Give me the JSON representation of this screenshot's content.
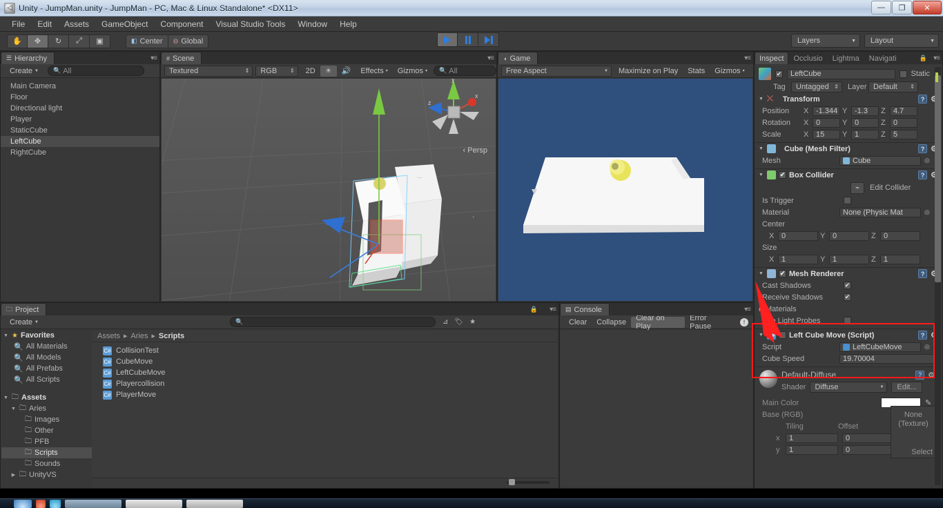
{
  "window": {
    "title": "Unity - JumpMan.unity - JumpMan - PC, Mac & Linux Standalone* <DX11>",
    "app_icon": "unity-icon",
    "minimize": "—",
    "restore": "❐",
    "close": "✕"
  },
  "menubar": {
    "items": [
      "File",
      "Edit",
      "Assets",
      "GameObject",
      "Component",
      "Visual Studio Tools",
      "Window",
      "Help"
    ]
  },
  "toolbar": {
    "tools": [
      {
        "name": "hand-tool",
        "glyph": "✋",
        "active": false
      },
      {
        "name": "move-tool",
        "glyph": "✥",
        "active": true
      },
      {
        "name": "rotate-tool",
        "glyph": "↻",
        "active": false
      },
      {
        "name": "scale-tool",
        "glyph": "⤢",
        "active": false
      },
      {
        "name": "rect-tool",
        "glyph": "▣",
        "active": false
      }
    ],
    "pivot_label": "Center",
    "space_label": "Global",
    "play_label": "Play",
    "pause_label": "Pause",
    "step_label": "Step",
    "layers_label": "Layers",
    "layout_label": "Layout"
  },
  "hierarchy": {
    "tab": "Hierarchy",
    "create_label": "Create",
    "search_placeholder": "All",
    "items": [
      {
        "label": "Main Camera",
        "selected": false
      },
      {
        "label": "Floor",
        "selected": false
      },
      {
        "label": "Directional light",
        "selected": false
      },
      {
        "label": "Player",
        "selected": false
      },
      {
        "label": "StaticCube",
        "selected": false
      },
      {
        "label": "LeftCube",
        "selected": true
      },
      {
        "label": "RightCube",
        "selected": false
      }
    ]
  },
  "scene": {
    "tab": "Scene",
    "draw_mode": "Textured",
    "color_mode": "RGB",
    "two_d": "2D",
    "effects": "Effects",
    "gizmos": "Gizmos",
    "search_placeholder": "All",
    "persp_label": "Persp",
    "axis_x": "x",
    "axis_y": "y",
    "axis_z": "z"
  },
  "game": {
    "tab": "Game",
    "aspect": "Free Aspect",
    "maximize": "Maximize on Play",
    "stats": "Stats",
    "gizmos": "Gizmos"
  },
  "project": {
    "tab": "Project",
    "create_label": "Create",
    "search_placeholder": "",
    "breadcrumb": [
      "Assets",
      "Aries",
      "Scripts"
    ],
    "favorites_label": "Favorites",
    "favorites": [
      "All Materials",
      "All Models",
      "All Prefabs",
      "All Scripts"
    ],
    "assets_label": "Assets",
    "tree": [
      {
        "label": "Aries",
        "depth": 1,
        "arrow": "▼",
        "selected": false
      },
      {
        "label": "Images",
        "depth": 2,
        "arrow": "",
        "selected": false
      },
      {
        "label": "Other",
        "depth": 2,
        "arrow": "",
        "selected": false
      },
      {
        "label": "PFB",
        "depth": 2,
        "arrow": "",
        "selected": false
      },
      {
        "label": "Scripts",
        "depth": 2,
        "arrow": "",
        "selected": true
      },
      {
        "label": "Sounds",
        "depth": 2,
        "arrow": "",
        "selected": false
      },
      {
        "label": "UnityVS",
        "depth": 1,
        "arrow": "▶",
        "selected": false
      }
    ],
    "assets": [
      {
        "label": "CollisionTest",
        "icon": "csharp-script-icon"
      },
      {
        "label": "CubeMove",
        "icon": "csharp-script-icon"
      },
      {
        "label": "LeftCubeMove",
        "icon": "csharp-script-icon"
      },
      {
        "label": "Playercollision",
        "icon": "csharp-script-icon"
      },
      {
        "label": "PlayerMove",
        "icon": "csharp-script-icon"
      }
    ]
  },
  "console": {
    "tab": "Console",
    "clear": "Clear",
    "collapse": "Collapse",
    "clear_on_play": "Clear on Play",
    "error_pause": "Error Pause",
    "error_icon": "error-icon"
  },
  "inspector": {
    "tabs": [
      "Inspect",
      "Occlusio",
      "Lightma",
      "Navigati"
    ],
    "active_tab": "Inspect",
    "object_name": "LeftCube",
    "object_enabled": true,
    "static_label": "Static",
    "tag_label": "Tag",
    "tag_value": "Untagged",
    "layer_label": "Layer",
    "layer_value": "Default",
    "transform": {
      "title": "Transform",
      "position_label": "Position",
      "position": {
        "x": "-1.344",
        "y": "-1.3",
        "z": "4.7"
      },
      "rotation_label": "Rotation",
      "rotation": {
        "x": "0",
        "y": "0",
        "z": "0"
      },
      "scale_label": "Scale",
      "scale": {
        "x": "15",
        "y": "1",
        "z": "5"
      }
    },
    "mesh_filter": {
      "title": "Cube (Mesh Filter)",
      "mesh_label": "Mesh",
      "mesh_value": "Cube"
    },
    "box_collider": {
      "title": "Box Collider",
      "enabled": true,
      "edit_collider_label": "Edit Collider",
      "is_trigger_label": "Is Trigger",
      "is_trigger": false,
      "material_label": "Material",
      "material_value": "None (Physic Mat",
      "center_label": "Center",
      "center": {
        "x": "0",
        "y": "0",
        "z": "0"
      },
      "size_label": "Size",
      "size": {
        "x": "1",
        "y": "1",
        "z": "1"
      }
    },
    "mesh_renderer": {
      "title": "Mesh Renderer",
      "enabled": true,
      "cast_shadows_label": "Cast Shadows",
      "cast_shadows": true,
      "receive_shadows_label": "Receive Shadows",
      "receive_shadows": true,
      "materials_label": "Materials",
      "use_light_probes_label": "Use Light Probes",
      "use_light_probes": false
    },
    "script_component": {
      "title": "Left Cube Move (Script)",
      "enabled": false,
      "script_label": "Script",
      "script_value": "LeftCubeMove",
      "cube_speed_label": "Cube Speed",
      "cube_speed_value": "19.70004",
      "highlighted": true
    },
    "material": {
      "title": "Default-Diffuse",
      "shader_label": "Shader",
      "shader_value": "Diffuse",
      "edit_label": "Edit...",
      "main_color_label": "Main Color",
      "base_rgb_label": "Base (RGB)",
      "tiling_label": "Tiling",
      "offset_label": "Offset",
      "texture_label": "None\n(Texture)",
      "select_label": "Select",
      "rows": [
        {
          "axis": "x",
          "tiling": "1",
          "offset": "0"
        },
        {
          "axis": "y",
          "tiling": "1",
          "offset": "0"
        }
      ]
    }
  },
  "colors": {
    "accent_blue": "#2d7fe0",
    "annotation_red": "#ff1a1a",
    "game_bg": "#2f4f7d",
    "panel_bg": "#383838"
  }
}
